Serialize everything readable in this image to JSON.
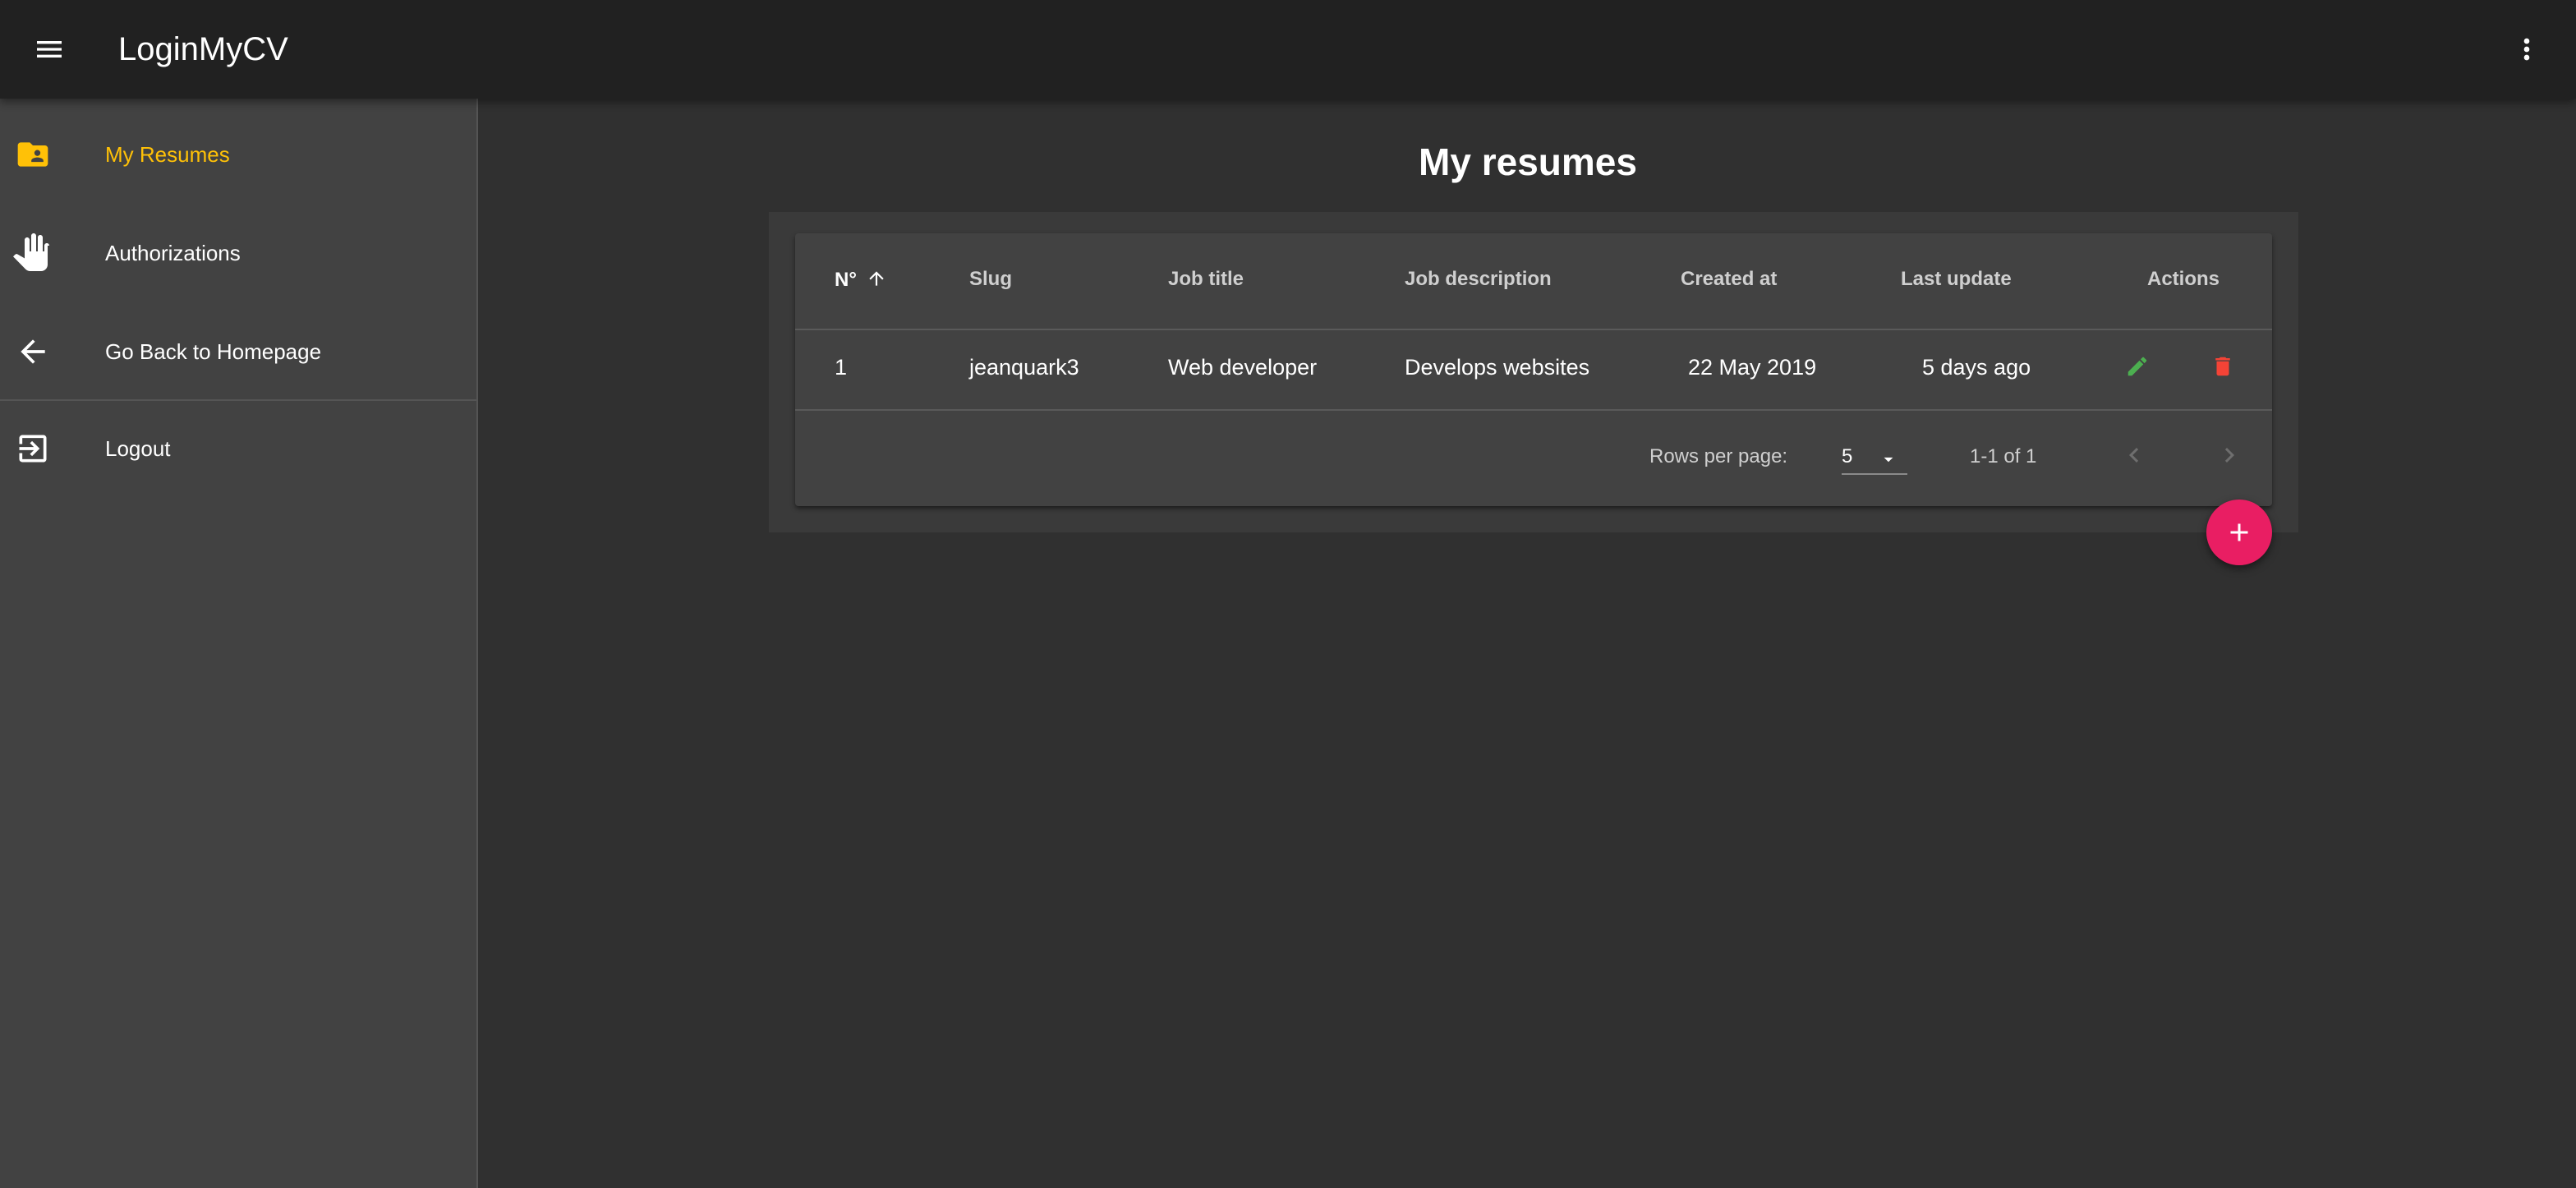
{
  "app": {
    "title": "LoginMyCV",
    "menu_icon": "hamburger-menu-icon",
    "more_icon": "more-vertical-icon"
  },
  "sidebar": {
    "items": [
      {
        "label": "My Resumes",
        "icon": "folder-account-icon",
        "active": true
      },
      {
        "label": "Authorizations",
        "icon": "hand-icon",
        "active": false
      },
      {
        "label": "Go Back to Homepage",
        "icon": "arrow-left-icon",
        "active": false
      },
      {
        "label": "Logout",
        "icon": "exit-icon",
        "active": false
      }
    ]
  },
  "main": {
    "title": "My resumes",
    "table": {
      "columns": [
        "N°",
        "Slug",
        "Job title",
        "Job description",
        "Created at",
        "Last update",
        "Actions"
      ],
      "sorted_column": "N°",
      "sort_direction": "ascending",
      "rows": [
        {
          "number": "1",
          "slug": "jeanquark3",
          "job_title": "Web developer",
          "job_description": "Develops websites",
          "created_at": "22 May 2019",
          "last_update": "5 days ago"
        }
      ],
      "footer": {
        "rows_per_page_label": "Rows per page:",
        "rows_per_page_value": "5",
        "range_text": "1-1 of 1"
      }
    },
    "fab_icon": "plus-icon"
  },
  "colors": {
    "appbar": "#212121",
    "background": "#303030",
    "sidebar": "#424242",
    "accent_active": "#ffc107",
    "edit": "#4caf50",
    "delete": "#f44336",
    "fab": "#e91e63"
  }
}
